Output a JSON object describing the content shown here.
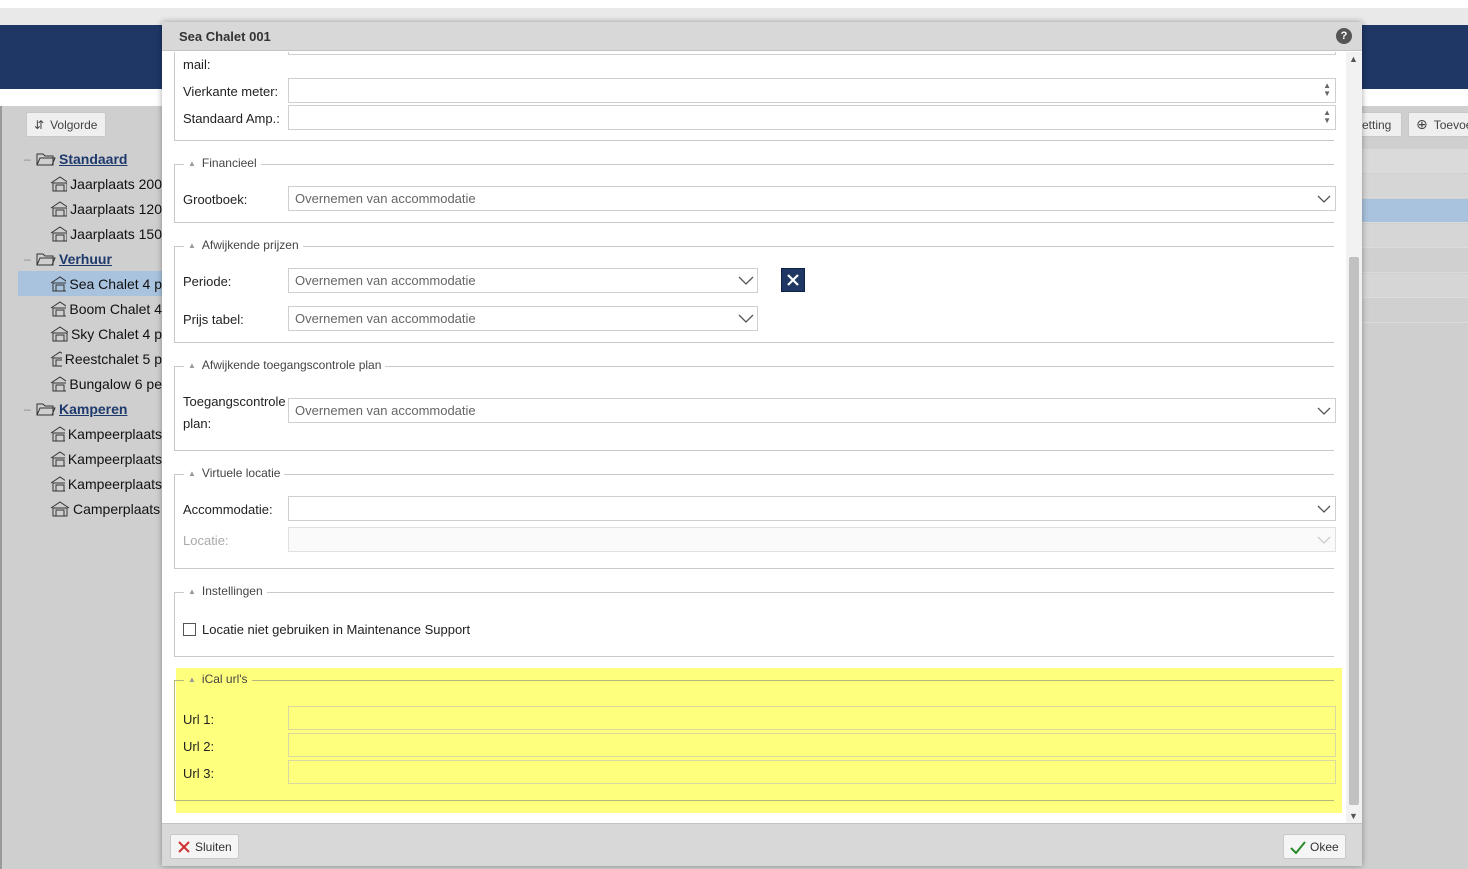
{
  "background": {
    "toolbar": {
      "order_label": "Volgorde",
      "setting_label": "etting",
      "add_label": "Toevoe"
    },
    "tree": [
      {
        "type": "folder",
        "label": "Standaard"
      },
      {
        "type": "leaf",
        "label": "Jaarplaats 200"
      },
      {
        "type": "leaf",
        "label": "Jaarplaats 120"
      },
      {
        "type": "leaf",
        "label": "Jaarplaats 150"
      },
      {
        "type": "folder",
        "label": "Verhuur"
      },
      {
        "type": "leaf",
        "label": "Sea Chalet 4 p",
        "selected": true
      },
      {
        "type": "leaf",
        "label": "Boom Chalet 4"
      },
      {
        "type": "leaf",
        "label": "Sky Chalet 4 p"
      },
      {
        "type": "leaf",
        "label": "Reestchalet 5 p"
      },
      {
        "type": "leaf",
        "label": "Bungalow 6 pe"
      },
      {
        "type": "folder",
        "label": "Kamperen"
      },
      {
        "type": "leaf",
        "label": "Kampeerplaats"
      },
      {
        "type": "leaf",
        "label": "Kampeerplaats"
      },
      {
        "type": "leaf",
        "label": "Kampeerplaats"
      },
      {
        "type": "leaf",
        "label": "Camperplaats"
      }
    ]
  },
  "dialog": {
    "title": "Sea Chalet 001",
    "help_icon": "question-icon",
    "fields_top": {
      "mail_label": "mail:",
      "square_meter_label": "Vierkante meter:",
      "square_meter_value": "",
      "amp_label": "Standaard Amp.:",
      "amp_value": ""
    },
    "financial": {
      "legend": "Financieel",
      "ledger_label": "Grootboek:",
      "ledger_value": "Overnemen van accommodatie"
    },
    "prices": {
      "legend": "Afwijkende prijzen",
      "period_label": "Periode:",
      "period_value": "Overnemen van accommodatie",
      "price_table_label": "Prijs tabel:",
      "price_table_value": "Overnemen van accommodatie"
    },
    "access": {
      "legend": "Afwijkende toegangscontrole plan",
      "plan_label_line1": "Toegangscontrole",
      "plan_label_line2": "plan:",
      "plan_value": "Overnemen van accommodatie"
    },
    "virtual": {
      "legend": "Virtuele locatie",
      "accommodation_label": "Accommodatie:",
      "accommodation_value": "",
      "location_label": "Locatie:",
      "location_value": ""
    },
    "settings": {
      "legend": "Instellingen",
      "checkbox_label": "Locatie niet gebruiken in Maintenance Support",
      "checked": false
    },
    "ical": {
      "legend": "iCal url's",
      "url1_label": "Url 1:",
      "url2_label": "Url 2:",
      "url3_label": "Url 3:",
      "url1_value": "",
      "url2_value": "",
      "url3_value": ""
    },
    "footer": {
      "close_label": "Sluiten",
      "ok_label": "Okee"
    }
  },
  "colors": {
    "header": "#1e3765",
    "highlight": "#ffff7e",
    "selected_row": "#a9c3de"
  }
}
